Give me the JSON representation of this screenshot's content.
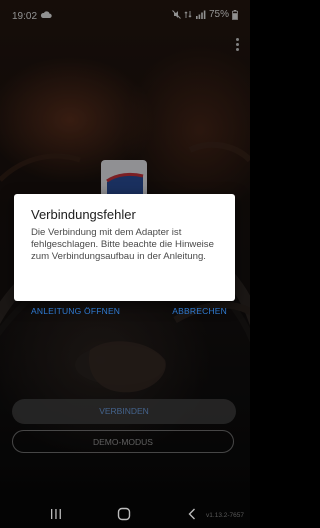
{
  "status_bar": {
    "time": "19:02",
    "battery": "75%"
  },
  "dialog": {
    "title": "Verbindungsfehler",
    "message": "Die Verbindung mit dem Adapter ist fehlgeschlagen. Bitte beachte die Hinweise zum Verbindungsaufbau in der Anleitung.",
    "open_manual_label": "ANLEITUNG ÖFFNEN",
    "cancel_label": "ABBRECHEN"
  },
  "main": {
    "connect_label": "VERBINDEN",
    "demo_label": "DEMO-MODUS"
  },
  "version": "v1.13.2-7657",
  "colors": {
    "accent": "#2f7ad1",
    "connect_text": "#6d9fe0"
  },
  "icons": [
    "cloud-icon",
    "mute-icon",
    "lte-icon",
    "signal-icon",
    "battery-icon",
    "more-vert-icon",
    "recents-icon",
    "home-icon",
    "back-icon"
  ]
}
